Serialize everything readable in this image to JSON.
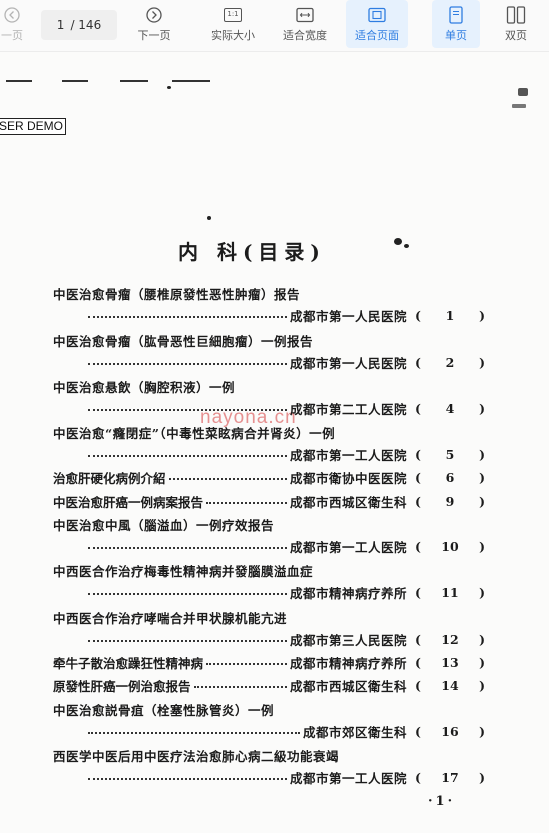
{
  "toolbar": {
    "prev_label": "一页",
    "page_current": "1",
    "page_total": "/ 146",
    "next_label": "下一页",
    "actual_size_label": "实际大小",
    "actual_size_glyph": "1:1",
    "fit_width_label": "适合宽度",
    "fit_page_label": "适合页面",
    "single_label": "单页",
    "double_label": "双页",
    "accent_color": "#2f7de1",
    "active_bg": "#e6f1fd"
  },
  "document": {
    "watermark_demo": "SER DEMO",
    "watermark_site": "nayona.cn",
    "title": "内 科(目录)",
    "page_number": "·1·",
    "entries": [
      {
        "title": "中医治愈骨瘤（腰椎原發性恶性肿瘤）报告",
        "hospital": "成都市第一人民医院",
        "open": "(",
        "page": "1",
        "close": ")"
      },
      {
        "title": "中医治愈骨瘤（肱骨恶性巨細胞瘤）一例报告",
        "hospital": "成都市第一人民医院",
        "open": "(",
        "page": "2",
        "close": ")"
      },
      {
        "title": "中医治愈悬飲（胸腔积液）一例",
        "hospital": "成都市第二工人医院",
        "open": "(",
        "page": "4",
        "close": ")"
      },
      {
        "title": "中医治愈“癃閉症”（中毒性菜眩病合并肾炎）一例",
        "hospital": "成都市第一工人医院",
        "open": "(",
        "page": "5",
        "close": ")"
      },
      {
        "title": "治愈肝硬化病例介紹",
        "hospital": "成都市衛协中医医院",
        "open": "(",
        "page": "6",
        "close": ")"
      },
      {
        "title": "中医治愈肝癌一例病案报告",
        "hospital": "成都市西城区衛生科",
        "open": "(",
        "page": "9",
        "close": ")"
      },
      {
        "title": "中医治愈中風（腦溢血）一例疗效报告",
        "hospital": "成都市第一工人医院",
        "open": "(",
        "page": "10",
        "close": ")"
      },
      {
        "title": "中西医合作治疗梅毒性精神病并發腦膜溢血症",
        "hospital": "成都市精神病疗养所",
        "open": "(",
        "page": "11",
        "close": ")"
      },
      {
        "title": "中西医合作治疗哮喘合并甲状腺机能亢进",
        "hospital": "成都市第三人民医院",
        "open": "(",
        "page": "12",
        "close": ")"
      },
      {
        "title": "牵牛子散治愈躁狂性精神病",
        "hospital": "成都市精神病疗养所",
        "open": "(",
        "page": "13",
        "close": ")"
      },
      {
        "title": "原發性肝癌一例治愈报告",
        "hospital": "成都市西城区衛生科",
        "open": "(",
        "page": "14",
        "close": ")"
      },
      {
        "title": "中医治愈説骨疽（栓塞性脉管炎）一例",
        "hospital": "成都市郊区衛生科",
        "open": "(",
        "page": "16",
        "close": ")"
      },
      {
        "title": "西医学中医后用中医疗法治愈肺心病二級功能衰竭",
        "hospital": "成都市第一工人医院",
        "open": "(",
        "page": "17",
        "close": ")"
      }
    ]
  }
}
